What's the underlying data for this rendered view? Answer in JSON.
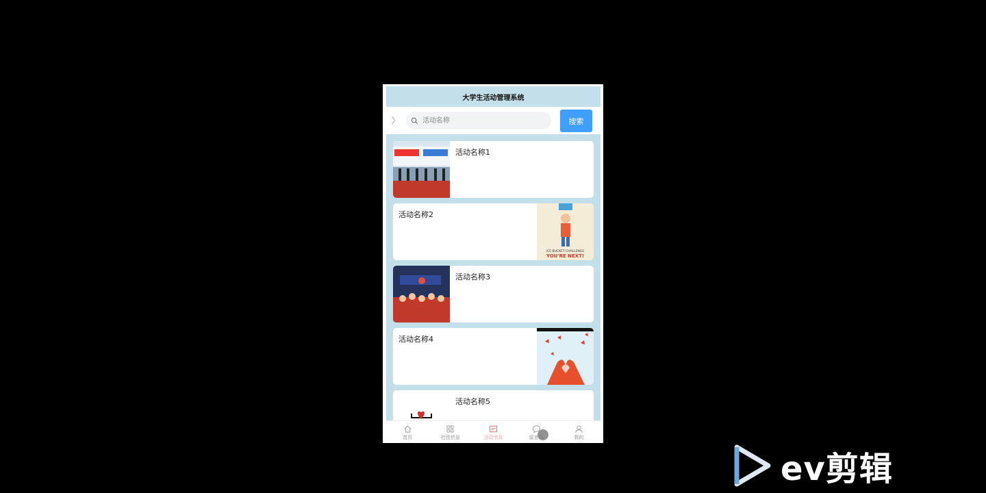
{
  "app": {
    "title": "大学生活动管理系统"
  },
  "search": {
    "placeholder": "活动名称",
    "button_label": "搜索"
  },
  "activities": [
    {
      "name": "活动名称1",
      "image_side": "left",
      "image_icon": "event-ceremony-photo"
    },
    {
      "name": "活动名称2",
      "image_side": "right",
      "image_icon": "ice-bucket-challenge-poster"
    },
    {
      "name": "活动名称3",
      "image_side": "left",
      "image_icon": "group-photo"
    },
    {
      "name": "活动名称4",
      "image_side": "right",
      "image_icon": "heart-hands-butterflies"
    },
    {
      "name": "活动名称5",
      "image_side": "left",
      "image_icon": "red-heart-image"
    }
  ],
  "poster_text": {
    "line1": "ICE BUCKET CHALLENGE",
    "line2": "YOU'RE NEXT!"
  },
  "tabs": [
    {
      "label": "首页",
      "icon": "home-icon",
      "active": false
    },
    {
      "label": "社团信息",
      "icon": "grid-icon",
      "active": false
    },
    {
      "label": "活动信息",
      "icon": "news-icon",
      "active": true
    },
    {
      "label": "留言板",
      "icon": "message-icon",
      "active": false
    },
    {
      "label": "我的",
      "icon": "user-icon",
      "active": false
    }
  ],
  "watermark": {
    "text": "ev剪辑"
  },
  "colors": {
    "header_bg": "#c3dfe9",
    "accent": "#409eff",
    "active_tab": "#e4a9a9"
  }
}
